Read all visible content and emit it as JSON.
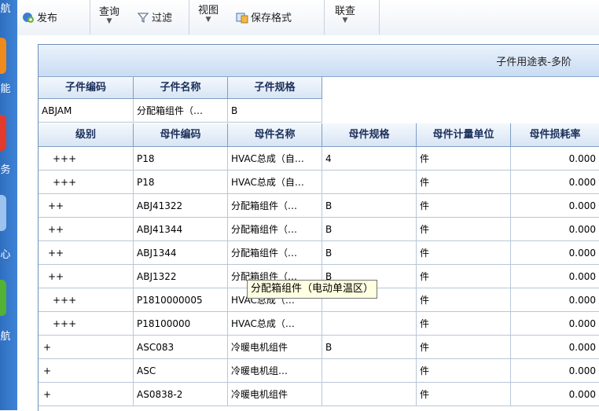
{
  "sidebar": {
    "labels": [
      "航",
      "能",
      "务",
      "心",
      "航"
    ]
  },
  "ribbon": {
    "publish": "发布",
    "query": "查询",
    "filter": "过滤",
    "view": "视图",
    "save_format": "保存格式",
    "link": "联查"
  },
  "panel": {
    "title": "子件用途表-多阶"
  },
  "child": {
    "headers": [
      "子件编码",
      "子件名称",
      "子件规格"
    ],
    "row": [
      "ABJAM",
      "分配箱组件（…",
      "B"
    ]
  },
  "table": {
    "headers": [
      "级别",
      "母件编码",
      "母件名称",
      "母件规格",
      "母件计量单位",
      "母件损耗率"
    ],
    "rows": [
      [
        "+++",
        "P18",
        "HVAC总成（自…",
        "4",
        "件",
        "0.000"
      ],
      [
        "+++",
        "P18",
        "HVAC总成（自…",
        "",
        "件",
        "0.000"
      ],
      [
        "++",
        "ABJ41322",
        "分配箱组件（…",
        "B",
        "件",
        "0.000"
      ],
      [
        "++",
        "ABJ41344",
        "分配箱组件（…",
        "B",
        "件",
        "0.000"
      ],
      [
        "++",
        "ABJ1344",
        "分配箱组件（…",
        "B",
        "件",
        "0.000"
      ],
      [
        "++",
        "ABJ1322",
        "分配箱组件（…",
        "B",
        "件",
        "0.000"
      ],
      [
        "+++",
        "P1810000005",
        "HVAC总成（…",
        "",
        "件",
        "0.000"
      ],
      [
        "+++",
        "P18100000",
        "HVAC总成（…",
        "",
        "件",
        "0.000"
      ],
      [
        "+",
        "ASC083",
        "冷暖电机组件",
        "B",
        "件",
        "0.000"
      ],
      [
        "+",
        "ASC",
        "冷暖电机组…",
        "",
        "件",
        "0.000"
      ],
      [
        "+",
        "AS0838-2",
        "冷暖电机组件",
        "",
        "件",
        "0.000"
      ]
    ]
  },
  "tooltip": "分配箱组件（电动单温区）"
}
